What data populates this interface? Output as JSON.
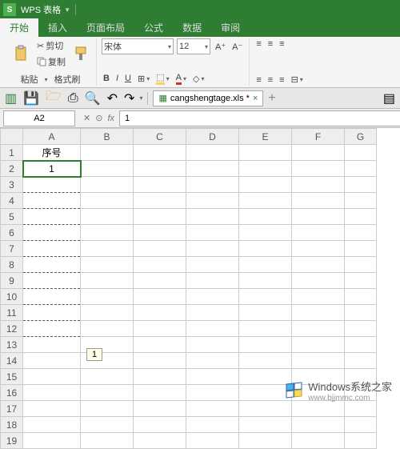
{
  "titlebar": {
    "app_name": "WPS 表格"
  },
  "tabs": {
    "start": "开始",
    "insert": "插入",
    "layout": "页面布局",
    "formula": "公式",
    "data": "数据",
    "review": "审阅"
  },
  "ribbon": {
    "cut": "剪切",
    "copy": "复制",
    "paste": "粘贴",
    "format_painter": "格式刷",
    "font_name": "宋体",
    "font_size": "12"
  },
  "filetab": {
    "name": "cangshengtage.xls *"
  },
  "namebox": {
    "value": "A2"
  },
  "formula": {
    "value": "1",
    "fx": "fx"
  },
  "columns": [
    "A",
    "B",
    "C",
    "D",
    "E",
    "F",
    "G"
  ],
  "rows": [
    "1",
    "2",
    "3",
    "4",
    "5",
    "6",
    "7",
    "8",
    "9",
    "10",
    "11",
    "12",
    "13",
    "14",
    "15",
    "16",
    "17",
    "18",
    "19"
  ],
  "cells": {
    "A1": "序号",
    "A2": "1"
  },
  "drag_tip": "1",
  "watermark": {
    "brand": "Windows系统之家",
    "url": "www.bjjmmc.com"
  }
}
